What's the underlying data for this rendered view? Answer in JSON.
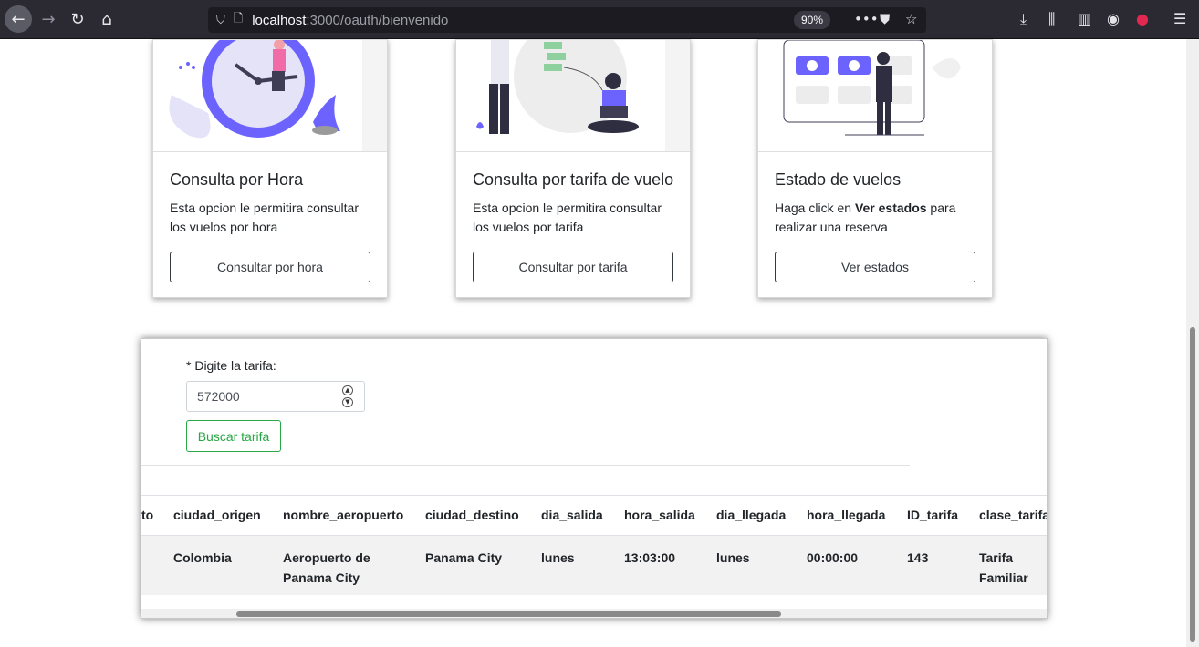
{
  "browser": {
    "url_host": "localhost",
    "url_rest": ":3000/oauth/bienvenido",
    "zoom": "90%",
    "icons": [
      "back-icon",
      "forward-icon",
      "reload-icon",
      "home-icon",
      "shield-icon",
      "page-icon",
      "more-icon",
      "pocket-icon",
      "bookmark-star-icon",
      "download-icon",
      "library-icon",
      "sidebar-icon",
      "account-icon",
      "extension-lock-icon",
      "menu-icon"
    ]
  },
  "cards": [
    {
      "title": "Consulta por Hora",
      "text": "Esta opcion le permitira consultar los vuelos por hora",
      "button": "Consultar por hora"
    },
    {
      "title": "Consulta por tarifa de vuelo",
      "text": "Esta opcion le permitira consultar los vuelos por tarifa",
      "button": "Consultar por tarifa"
    },
    {
      "title": "Estado de vuelos",
      "text_pre": "Haga click en ",
      "text_bold": "Ver estados",
      "text_post": " para realizar una reserva",
      "button": "Ver estados"
    }
  ],
  "form": {
    "label": "* Digite la tarifa:",
    "value": "572000",
    "button": "Buscar tarifa"
  },
  "table": {
    "headers": [
      "to",
      "ciudad_origen",
      "nombre_aeropuerto",
      "ciudad_destino",
      "dia_salida",
      "hora_salida",
      "dia_llegada",
      "hora_llegada",
      "ID_tarifa",
      "clase_tarifa"
    ],
    "row": [
      "",
      "Colombia",
      "Aeropuerto de Panama City",
      "Panama City",
      "lunes",
      "13:03:00",
      "lunes",
      "00:00:00",
      "143",
      "Tarifa Familiar"
    ]
  },
  "colors": {
    "accent_purple": "#6c63ff",
    "success_green": "#28a745",
    "chrome_dark": "#2b2a33"
  }
}
